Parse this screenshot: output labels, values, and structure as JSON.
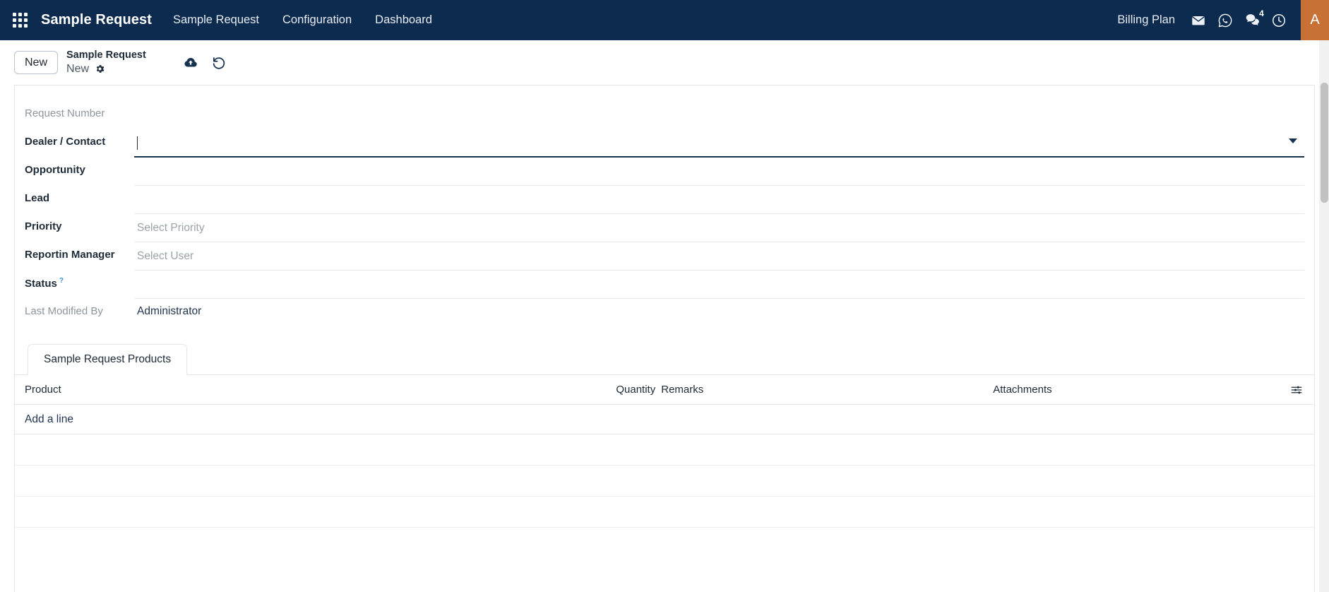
{
  "navbar": {
    "apps_icon": "apps-grid-icon",
    "brand": "Sample Request",
    "items": [
      {
        "label": "Sample Request"
      },
      {
        "label": "Configuration"
      },
      {
        "label": "Dashboard"
      }
    ],
    "billing_plan": "Billing Plan",
    "icons": [
      {
        "name": "mail-icon"
      },
      {
        "name": "whatsapp-icon"
      },
      {
        "name": "chat-icon",
        "badge": "4"
      },
      {
        "name": "clock-icon"
      }
    ],
    "avatar_initial": "A"
  },
  "page_head": {
    "new_button": "New",
    "title": "Sample Request",
    "subtitle": "New",
    "gear_icon": "gear-icon",
    "actions": [
      {
        "name": "cloud-upload-icon"
      },
      {
        "name": "undo-icon"
      }
    ]
  },
  "form": {
    "fields": [
      {
        "label": "Request Number",
        "label_style": "muted",
        "value": "",
        "placeholder": "",
        "type": "readonly"
      },
      {
        "label": "Dealer / Contact",
        "label_style": "bold",
        "value": "",
        "placeholder": "",
        "type": "link",
        "focused": true,
        "has_dropdown": true
      },
      {
        "label": "Opportunity",
        "label_style": "bold",
        "value": "",
        "placeholder": "",
        "type": "link"
      },
      {
        "label": "Lead",
        "label_style": "bold",
        "value": "",
        "placeholder": "",
        "type": "link"
      },
      {
        "label": "Priority",
        "label_style": "bold",
        "value": "",
        "placeholder": "Select Priority",
        "type": "select"
      },
      {
        "label": "Reportin Manager",
        "label_style": "bold",
        "value": "",
        "placeholder": "Select User",
        "type": "link"
      },
      {
        "label": "Status",
        "label_style": "bold",
        "value": "",
        "placeholder": "",
        "type": "select",
        "help": "?"
      },
      {
        "label": "Last Modified By",
        "label_style": "muted",
        "value": "Administrator",
        "placeholder": "",
        "type": "readonly"
      }
    ]
  },
  "tabs": [
    {
      "label": "Sample Request Products",
      "active": true
    }
  ],
  "grid": {
    "columns": [
      "Product",
      "Quantity",
      "Remarks",
      "Attachments"
    ],
    "settings_icon": "sliders-icon",
    "add_line": "Add a line",
    "rows": []
  }
}
